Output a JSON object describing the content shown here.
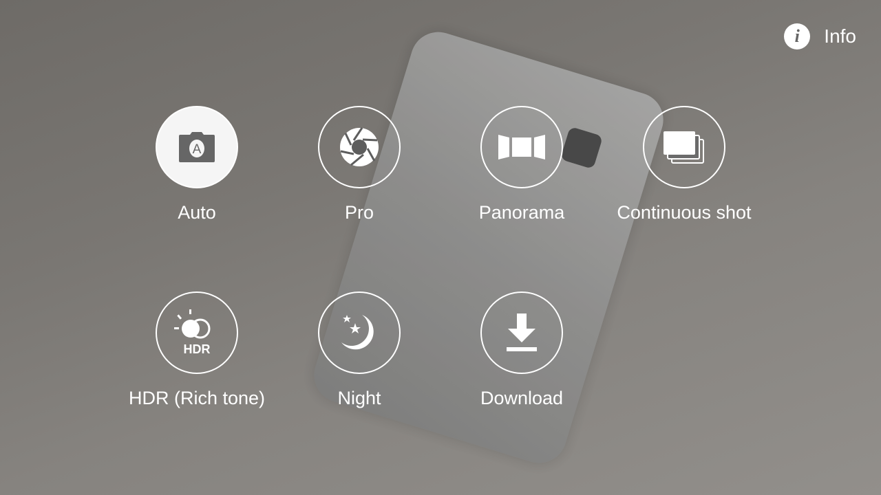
{
  "info": {
    "label": "Info",
    "icon": "info-icon"
  },
  "modes": [
    {
      "label": "Auto",
      "icon": "camera-auto-icon",
      "selected": true
    },
    {
      "label": "Pro",
      "icon": "aperture-icon",
      "selected": false
    },
    {
      "label": "Panorama",
      "icon": "panorama-icon",
      "selected": false
    },
    {
      "label": "Continuous shot",
      "icon": "continuous-shot-icon",
      "selected": false
    },
    {
      "label": "HDR (Rich tone)",
      "icon": "hdr-icon",
      "icon_text": "HDR",
      "selected": false
    },
    {
      "label": "Night",
      "icon": "night-moon-icon",
      "selected": false
    },
    {
      "label": "Download",
      "icon": "download-icon",
      "selected": false
    }
  ]
}
